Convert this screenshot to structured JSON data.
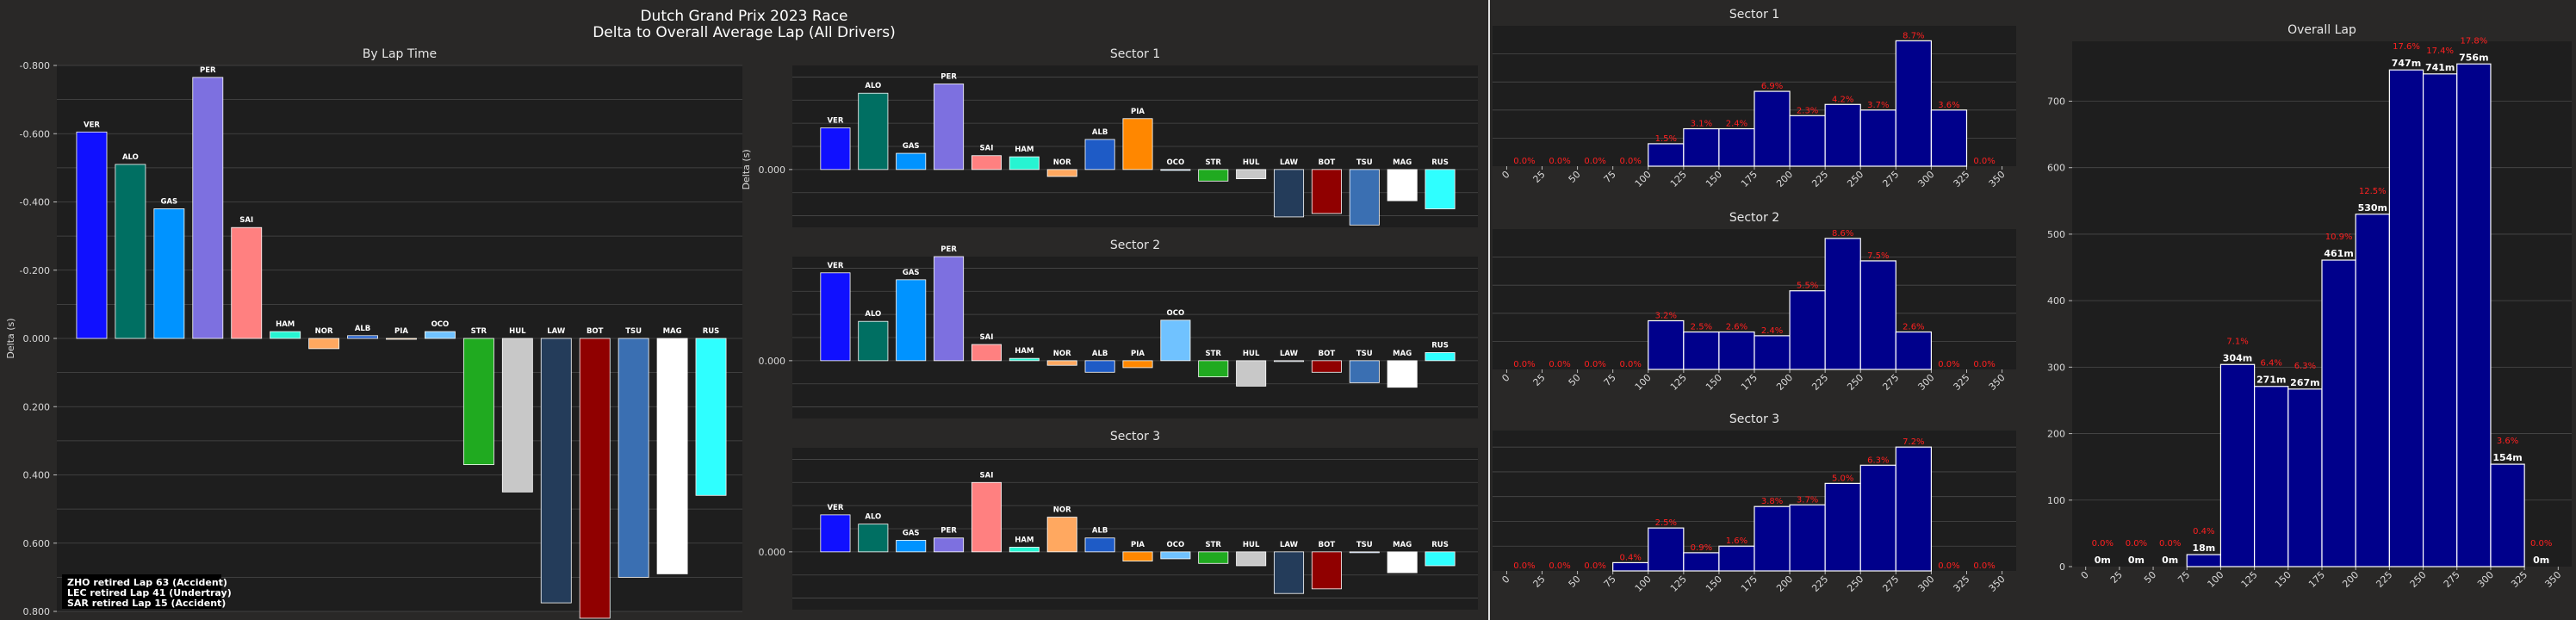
{
  "title_line1": "Dutch Grand Prix 2023 Race",
  "title_line2": "Delta to Overall Average Lap (All Drivers)",
  "ylabel_delta": "Delta (s)",
  "retirements": [
    "ZHO retired Lap 63 (Accident)",
    "LEC retired Lap 41 (Undertray)",
    "SAR retired Lap 15 (Accident)"
  ],
  "colors": {
    "VER": "#1010ff",
    "ALO": "#006f62",
    "GAS": "#0093ff",
    "PER": "#7d70e0",
    "SAI": "#ff8080",
    "HAM": "#27f4d2",
    "NOR": "#ffa860",
    "ALB": "#1e5bc6",
    "PIA": "#ff8700",
    "OCO": "#70c2ff",
    "STR": "#229971",
    "HUL": "#c8c8c8",
    "LAW": "#243c5a",
    "BOT": "#900000",
    "TSU": "#3a6fb2",
    "MAG": "#ffffff",
    "RUS": "#2fffff",
    "STR_main": "#20aa20",
    "STR_sector": "#20aa20",
    "histogram_fill": "#00008b",
    "histogram_edge": "#ffffff",
    "pct_label": "#ff2020"
  },
  "chart_data": [
    {
      "type": "bar",
      "id": "by-lap",
      "title": "By Lap Time",
      "ylabel": "Delta (s)",
      "invert_y": true,
      "ylim": [
        -0.8,
        0.8
      ],
      "yticks": [
        "-0.800",
        "-0.600",
        "-0.400",
        "-0.200",
        "0.000",
        "0.200",
        "0.400",
        "0.600",
        "0.800"
      ],
      "categories": [
        "VER",
        "ALO",
        "GAS",
        "PER",
        "SAI",
        "HAM",
        "NOR",
        "ALB",
        "PIA",
        "OCO",
        "STR",
        "HUL",
        "LAW",
        "BOT",
        "TSU",
        "MAG",
        "RUS"
      ],
      "values": [
        -0.605,
        -0.51,
        -0.38,
        -0.765,
        -0.325,
        -0.02,
        0.03,
        -0.008,
        0.0,
        -0.02,
        0.37,
        0.45,
        0.775,
        0.82,
        0.7,
        0.69,
        0.46
      ]
    },
    {
      "type": "bar",
      "id": "sector-1",
      "title": "Sector 1",
      "ylabel": "Delta (s)",
      "invert_y": true,
      "ylim": [
        -0.45,
        0.25
      ],
      "yticks": [
        "0.000"
      ],
      "categories": [
        "VER",
        "ALO",
        "GAS",
        "PER",
        "SAI",
        "HAM",
        "NOR",
        "ALB",
        "PIA",
        "OCO",
        "STR",
        "HUL",
        "LAW",
        "BOT",
        "TSU",
        "MAG",
        "RUS"
      ],
      "values": [
        -0.18,
        -0.33,
        -0.07,
        -0.37,
        -0.06,
        -0.055,
        0.03,
        -0.13,
        -0.22,
        0.003,
        0.05,
        0.04,
        0.205,
        0.19,
        0.24,
        0.135,
        0.17
      ]
    },
    {
      "type": "bar",
      "id": "sector-2",
      "title": "Sector 2",
      "ylabel": "",
      "invert_y": true,
      "ylim": [
        -0.45,
        0.25
      ],
      "yticks": [
        "0.000"
      ],
      "categories": [
        "VER",
        "ALO",
        "GAS",
        "PER",
        "SAI",
        "HAM",
        "NOR",
        "ALB",
        "PIA",
        "OCO",
        "STR",
        "HUL",
        "LAW",
        "BOT",
        "TSU",
        "MAG",
        "RUS"
      ],
      "values": [
        -0.38,
        -0.17,
        -0.35,
        -0.45,
        -0.07,
        -0.01,
        0.02,
        0.05,
        0.03,
        -0.175,
        0.07,
        0.11,
        0.0,
        0.05,
        0.095,
        0.115,
        -0.035
      ]
    },
    {
      "type": "bar",
      "id": "sector-3",
      "title": "Sector 3",
      "ylabel": "",
      "invert_y": true,
      "ylim": [
        -0.45,
        0.25
      ],
      "yticks": [
        "0.000"
      ],
      "categories": [
        "VER",
        "ALO",
        "GAS",
        "PER",
        "SAI",
        "HAM",
        "NOR",
        "ALB",
        "PIA",
        "OCO",
        "STR",
        "HUL",
        "LAW",
        "BOT",
        "TSU",
        "MAG",
        "RUS"
      ],
      "values": [
        -0.16,
        -0.12,
        -0.05,
        -0.06,
        -0.3,
        -0.02,
        -0.15,
        -0.06,
        0.04,
        0.03,
        0.05,
        0.06,
        0.18,
        0.16,
        0.0,
        0.09,
        0.06
      ]
    },
    {
      "type": "bar",
      "id": "hist-sector-1",
      "title": "Sector 1",
      "x": [
        0,
        25,
        50,
        75,
        100,
        125,
        150,
        175,
        200,
        225,
        250,
        275,
        300,
        325,
        350
      ],
      "bins": [
        100,
        125,
        150,
        175,
        200,
        225,
        250,
        275,
        300
      ],
      "bin_width": 25,
      "values": [
        12,
        20,
        20,
        40,
        27,
        33,
        30,
        67,
        30
      ],
      "ylim": [
        0,
        75
      ],
      "pct_labels": [
        {
          "x": 12.5,
          "label": "0.0%"
        },
        {
          "x": 37.5,
          "label": "0.0%"
        },
        {
          "x": 62.5,
          "label": "0.0%"
        },
        {
          "x": 87.5,
          "label": "0.0%"
        },
        {
          "x": 112.5,
          "label": "1.5%"
        },
        {
          "x": 137.5,
          "label": "3.1%"
        },
        {
          "x": 162.5,
          "label": "2.4%"
        },
        {
          "x": 187.5,
          "label": "6.9%"
        },
        {
          "x": 212.5,
          "label": "2.3%"
        },
        {
          "x": 237.5,
          "label": "4.2%"
        },
        {
          "x": 262.5,
          "label": "3.7%"
        },
        {
          "x": 287.5,
          "label": "8.7%"
        },
        {
          "x": 312.5,
          "label": "3.6%"
        },
        {
          "x": 337.5,
          "label": "0.0%"
        }
      ]
    },
    {
      "type": "bar",
      "id": "hist-sector-2",
      "title": "Sector 2",
      "x": [
        0,
        25,
        50,
        75,
        100,
        125,
        150,
        175,
        200,
        225,
        250,
        275,
        300,
        325,
        350
      ],
      "bins": [
        100,
        125,
        150,
        175,
        200,
        225,
        250,
        275
      ],
      "bin_width": 25,
      "values": [
        26,
        20,
        20,
        18,
        42,
        70,
        58,
        20
      ],
      "ylim": [
        0,
        75
      ],
      "pct_labels": [
        {
          "x": 12.5,
          "label": "0.0%"
        },
        {
          "x": 37.5,
          "label": "0.0%"
        },
        {
          "x": 62.5,
          "label": "0.0%"
        },
        {
          "x": 87.5,
          "label": "0.0%"
        },
        {
          "x": 112.5,
          "label": "3.2%"
        },
        {
          "x": 137.5,
          "label": "2.5%"
        },
        {
          "x": 162.5,
          "label": "2.6%"
        },
        {
          "x": 187.5,
          "label": "2.4%"
        },
        {
          "x": 212.5,
          "label": "5.5%"
        },
        {
          "x": 237.5,
          "label": "8.6%"
        },
        {
          "x": 262.5,
          "label": "7.5%"
        },
        {
          "x": 287.5,
          "label": "2.6%"
        },
        {
          "x": 312.5,
          "label": "0.0%"
        },
        {
          "x": 337.5,
          "label": "0.0%"
        }
      ]
    },
    {
      "type": "bar",
      "id": "hist-sector-3",
      "title": "Sector 3",
      "x": [
        0,
        25,
        50,
        75,
        100,
        125,
        150,
        175,
        200,
        225,
        250,
        275,
        300,
        325,
        350
      ],
      "bins": [
        75,
        100,
        125,
        150,
        175,
        200,
        225,
        250,
        275
      ],
      "bin_width": 25,
      "values": [
        5,
        26,
        11,
        15,
        39,
        40,
        53,
        64,
        75
      ],
      "ylim": [
        0,
        85
      ],
      "pct_labels": [
        {
          "x": 12.5,
          "label": "0.0%"
        },
        {
          "x": 37.5,
          "label": "0.0%"
        },
        {
          "x": 62.5,
          "label": "0.0%"
        },
        {
          "x": 87.5,
          "label": "0.4%"
        },
        {
          "x": 112.5,
          "label": "2.5%"
        },
        {
          "x": 137.5,
          "label": "0.9%"
        },
        {
          "x": 162.5,
          "label": "1.6%"
        },
        {
          "x": 187.5,
          "label": "3.8%"
        },
        {
          "x": 212.5,
          "label": "3.7%"
        },
        {
          "x": 237.5,
          "label": "5.0%"
        },
        {
          "x": 262.5,
          "label": "6.3%"
        },
        {
          "x": 287.5,
          "label": "7.2%"
        },
        {
          "x": 312.5,
          "label": "0.0%"
        },
        {
          "x": 337.5,
          "label": "0.0%"
        }
      ]
    },
    {
      "type": "bar",
      "id": "hist-overall",
      "title": "Overall Lap",
      "x": [
        0,
        25,
        50,
        75,
        100,
        125,
        150,
        175,
        200,
        225,
        250,
        275,
        300,
        325,
        350
      ],
      "bins": [
        0,
        25,
        50,
        75,
        100,
        125,
        150,
        175,
        200,
        225,
        250,
        275,
        300,
        325
      ],
      "bin_width": 25,
      "values": [
        0,
        0,
        0,
        18,
        304,
        271,
        267,
        461,
        530,
        747,
        741,
        756,
        154,
        0
      ],
      "value_labels": [
        "0m",
        "0m",
        "0m",
        "18m",
        "304m",
        "271m",
        "267m",
        "461m",
        "530m",
        "747m",
        "741m",
        "756m",
        "154m",
        "0m"
      ],
      "yticks": [
        0,
        100,
        200,
        300,
        400,
        500,
        600,
        700
      ],
      "ylim": [
        0,
        790
      ],
      "pct_labels": [
        {
          "x": 12.5,
          "label": "0.0%"
        },
        {
          "x": 37.5,
          "label": "0.0%"
        },
        {
          "x": 62.5,
          "label": "0.0%"
        },
        {
          "x": 87.5,
          "label": "0.4%"
        },
        {
          "x": 112.5,
          "label": "7.1%"
        },
        {
          "x": 137.5,
          "label": "6.4%"
        },
        {
          "x": 162.5,
          "label": "6.3%"
        },
        {
          "x": 187.5,
          "label": "10.9%"
        },
        {
          "x": 212.5,
          "label": "12.5%"
        },
        {
          "x": 237.5,
          "label": "17.6%"
        },
        {
          "x": 262.5,
          "label": "17.4%"
        },
        {
          "x": 287.5,
          "label": "17.8%"
        },
        {
          "x": 312.5,
          "label": "3.6%"
        },
        {
          "x": 337.5,
          "label": "0.0%"
        }
      ]
    }
  ]
}
